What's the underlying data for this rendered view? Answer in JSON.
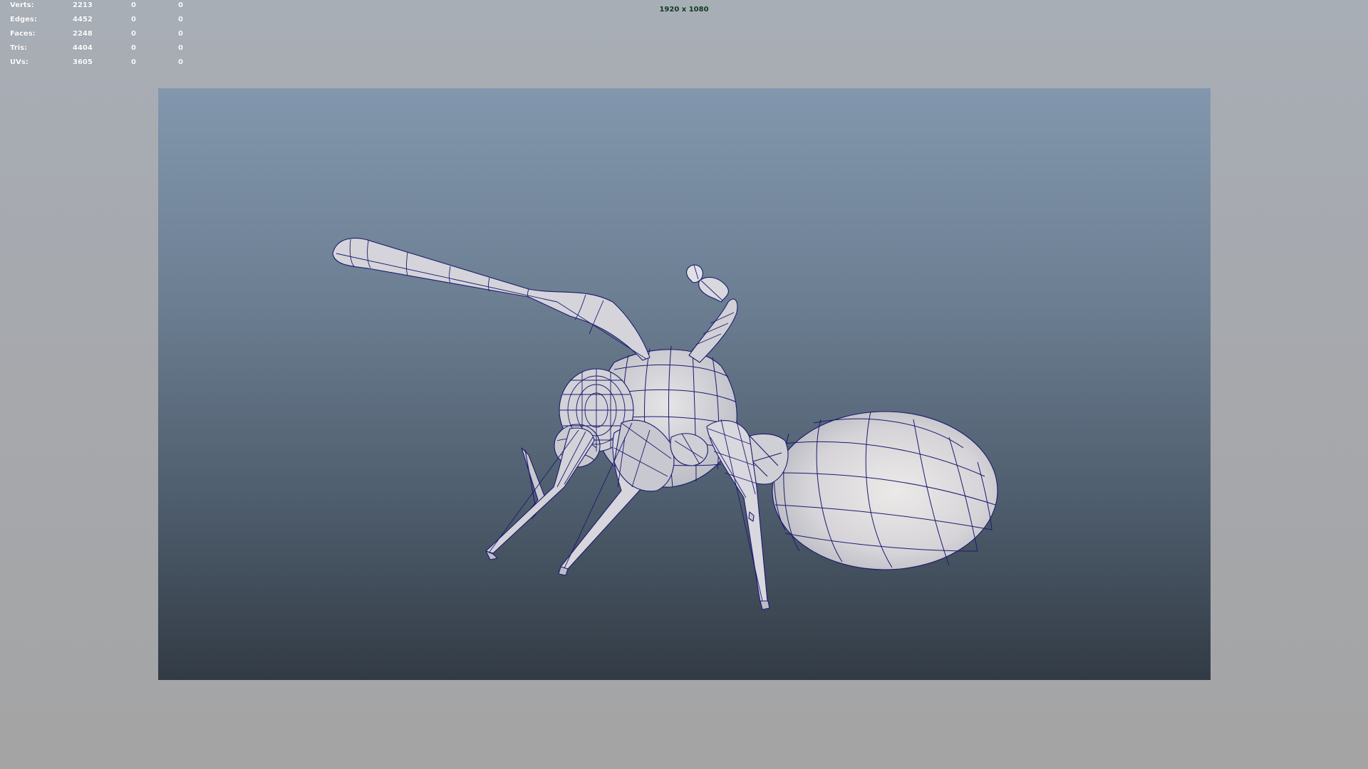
{
  "hud": {
    "stats": [
      {
        "label": "Verts:",
        "total": "2213",
        "selected": "0",
        "extra": "0"
      },
      {
        "label": "Edges:",
        "total": "4452",
        "selected": "0",
        "extra": "0"
      },
      {
        "label": "Faces:",
        "total": "2248",
        "selected": "0",
        "extra": "0"
      },
      {
        "label": "Tris:",
        "total": "4404",
        "selected": "0",
        "extra": "0"
      },
      {
        "label": "UVs:",
        "total": "3605",
        "selected": "0",
        "extra": "0"
      }
    ],
    "resolution": "1920 x 1080"
  },
  "colors": {
    "hud_text": "#ffffff",
    "resolution_text": "#0f3a1e",
    "wireframe": "#1c1a6e",
    "mesh_fill": "#d6d4d8"
  },
  "viewport": {
    "subject": "ant-wireframe-model"
  }
}
